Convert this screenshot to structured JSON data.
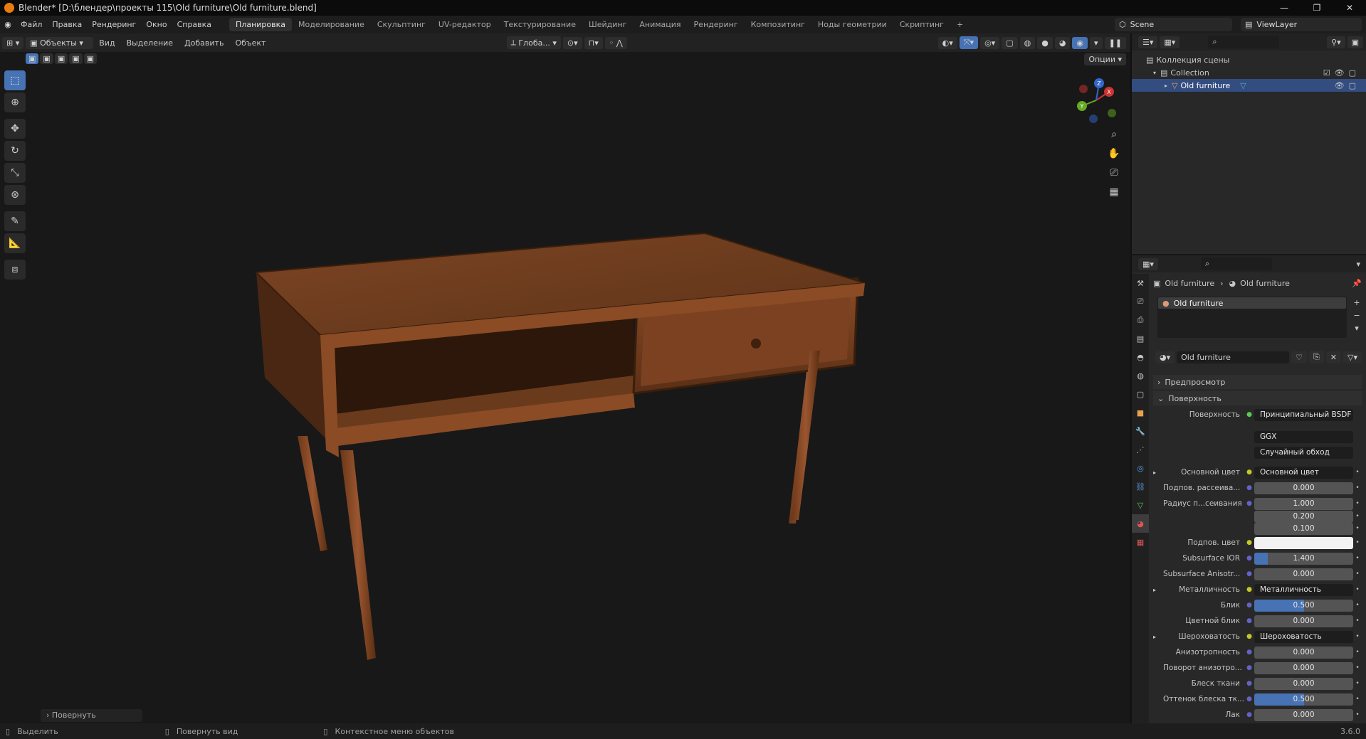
{
  "window": {
    "title": "Blender* [D:\\блендер\\проекты 115\\Old furniture\\Old furniture.blend]",
    "controls": [
      "—",
      "❐",
      "✕"
    ]
  },
  "menu": [
    "Файл",
    "Правка",
    "Рендеринг",
    "Окно",
    "Справка"
  ],
  "workspaces": [
    "Планировка",
    "Моделирование",
    "Скульптинг",
    "UV-редактор",
    "Текстурирование",
    "Шейдинг",
    "Анимация",
    "Рендеринг",
    "Композитинг",
    "Ноды геометрии",
    "Скриптинг"
  ],
  "add_workspace": "+",
  "scene": "Scene",
  "view_layer": "ViewLayer",
  "viewport_header": {
    "mode": "Объекты",
    "menus": [
      "Вид",
      "Выделение",
      "Добавить",
      "Объект"
    ],
    "orientation": "Глоба...",
    "options": "Опции"
  },
  "last_operator": "Повернуть",
  "outliner": {
    "root": "Коллекция сцены",
    "collection": "Collection",
    "object": "Old furniture"
  },
  "properties": {
    "breadcrumb_object": "Old furniture",
    "breadcrumb_material": "Old furniture",
    "slot": "Old furniture",
    "material_name": "Old furniture",
    "panel_preview": "Предпросмотр",
    "panel_surface": "Поверхность",
    "surface_label": "Поверхность",
    "surface_value": "Принципиальный BSDF",
    "distribution": "GGX",
    "subsurface_method": "Случайный обход",
    "rows": [
      {
        "label": "Основной цвет",
        "value": "Основной цвет"
      },
      {
        "label": "Подпов. рассеива...",
        "value": "0.000"
      },
      {
        "label": "Радиус п...сеивания",
        "value": "1.000"
      },
      {
        "label": "",
        "value": "0.200"
      },
      {
        "label": "",
        "value": "0.100"
      },
      {
        "label": "Подпов. цвет",
        "value": ""
      },
      {
        "label": "Subsurface IOR",
        "value": "1.400"
      },
      {
        "label": "Subsurface Anisotr...",
        "value": "0.000"
      },
      {
        "label": "Металличность",
        "value": "Металличность"
      },
      {
        "label": "Блик",
        "value": "0.500"
      },
      {
        "label": "Цветной блик",
        "value": "0.000"
      },
      {
        "label": "Шероховатость",
        "value": "Шероховатость"
      },
      {
        "label": "Анизотропность",
        "value": "0.000"
      },
      {
        "label": "Поворот анизотро...",
        "value": "0.000"
      },
      {
        "label": "Блеск ткани",
        "value": "0.000"
      },
      {
        "label": "Оттенок блеска тк...",
        "value": "0.500"
      },
      {
        "label": "Лак",
        "value": "0.000"
      }
    ]
  },
  "status": {
    "select": "Выделить",
    "rotate_view": "Повернуть вид",
    "context_menu": "Контекстное меню объектов",
    "version": "3.6.0"
  },
  "gizmo_axes": [
    "X",
    "Y",
    "Z"
  ],
  "colors": {
    "accent": "#4772b3",
    "active_tab": "#303030",
    "wood": "#7a4220"
  }
}
